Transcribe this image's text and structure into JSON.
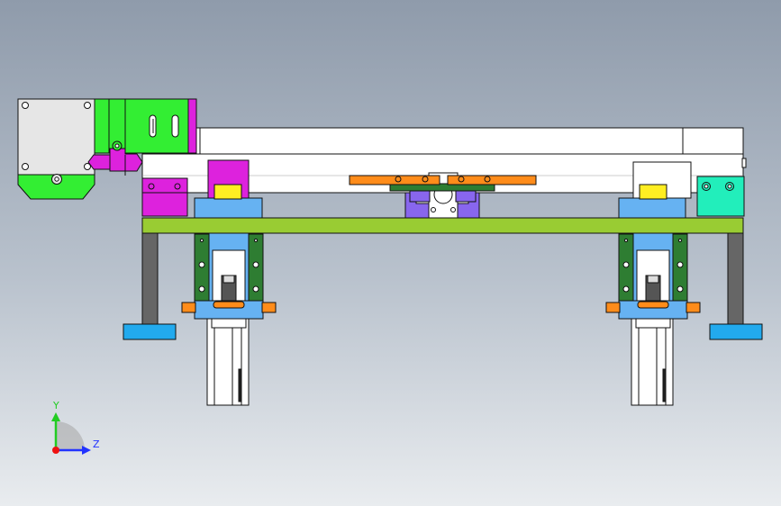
{
  "triad": {
    "y_label": "Y",
    "z_label": "Z"
  },
  "colors": {
    "background_top": "#8f9bab",
    "background_bottom": "#e9ecef",
    "plate_green": "#99cc33",
    "motor_grey": "#e6e6e6",
    "motor_green": "#33ee33",
    "magenta": "#dd22dd",
    "blue": "#66b2f2",
    "cyan_foot": "#22aaee",
    "dark_green": "#2e7d32",
    "orange": "#ff8c1a",
    "yellow": "#ffee22",
    "purple": "#8866ee",
    "teal": "#22eebb",
    "post_grey": "#666666",
    "axis_y": "#22cc22",
    "axis_z": "#2233ff",
    "axis_x": "#ee1111"
  },
  "icons": [
    "cad-assembly-drawing",
    "view-orientation-triad-icon"
  ]
}
